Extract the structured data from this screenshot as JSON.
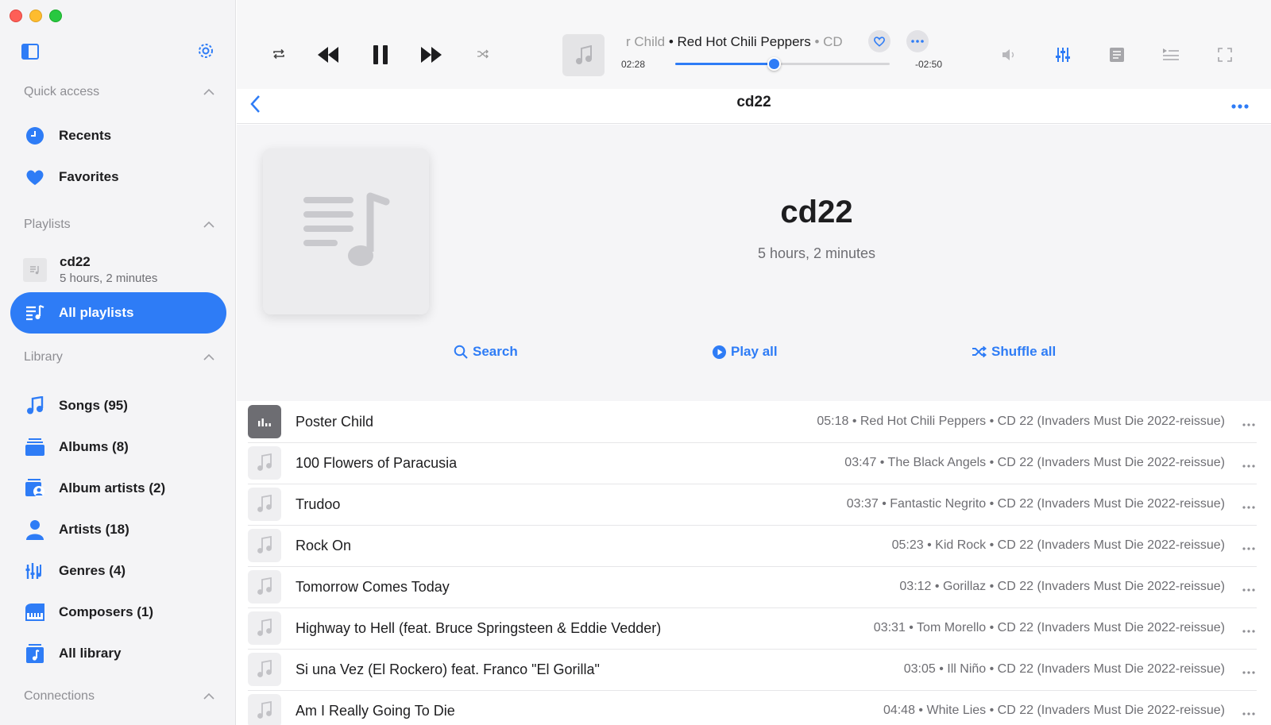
{
  "window": {
    "title": "cd22"
  },
  "sidebar": {
    "quick_access": {
      "heading": "Quick access",
      "items": [
        {
          "label": "Recents",
          "icon": "clock-icon"
        },
        {
          "label": "Favorites",
          "icon": "heart-icon"
        }
      ]
    },
    "playlists": {
      "heading": "Playlists",
      "playlist": {
        "title": "cd22",
        "subtitle": "5 hours, 2 minutes"
      },
      "all_label": "All playlists"
    },
    "library": {
      "heading": "Library",
      "items": [
        {
          "label": "Songs (95)",
          "icon": "music-note-icon"
        },
        {
          "label": "Albums (8)",
          "icon": "albums-icon"
        },
        {
          "label": "Album artists (2)",
          "icon": "album-artists-icon"
        },
        {
          "label": "Artists (18)",
          "icon": "person-icon"
        },
        {
          "label": "Genres (4)",
          "icon": "genres-icon"
        },
        {
          "label": "Composers (1)",
          "icon": "piano-icon"
        },
        {
          "label": "All library",
          "icon": "library-icon"
        }
      ]
    },
    "connections": {
      "heading": "Connections"
    }
  },
  "player": {
    "now_playing_prefix": "r Child",
    "now_playing_artist": " • Red Hot Chili Peppers",
    "now_playing_suffix": " • CD",
    "elapsed": "02:28",
    "remaining": "-02:50",
    "progress": 0.46
  },
  "header": {
    "title": "cd22"
  },
  "hero": {
    "title": "cd22",
    "subtitle": "5 hours, 2 minutes",
    "search_label": "Search",
    "play_all_label": "Play all",
    "shuffle_label": "Shuffle all"
  },
  "tracks": [
    {
      "title": "Poster Child",
      "meta": "05:18 • Red Hot Chili Peppers • CD 22 (Invaders Must Die 2022-reissue)",
      "playing": true
    },
    {
      "title": "100 Flowers of Paracusia",
      "meta": "03:47 • The Black Angels • CD 22 (Invaders Must Die 2022-reissue)"
    },
    {
      "title": "Trudoo",
      "meta": "03:37 • Fantastic Negrito • CD 22 (Invaders Must Die 2022-reissue)"
    },
    {
      "title": "Rock On",
      "meta": "05:23 • Kid Rock • CD 22 (Invaders Must Die 2022-reissue)"
    },
    {
      "title": "Tomorrow Comes Today",
      "meta": "03:12 • Gorillaz • CD 22 (Invaders Must Die 2022-reissue)"
    },
    {
      "title": "Highway to Hell (feat. Bruce Springsteen & Eddie Vedder)",
      "meta": "03:31 • Tom Morello • CD 22 (Invaders Must Die 2022-reissue)"
    },
    {
      "title": "Si una Vez (El Rockero) feat. Franco \"El Gorilla\"",
      "meta": "03:05 • Ill Niño • CD 22 (Invaders Must Die 2022-reissue)"
    },
    {
      "title": "Am I Really Going To Die",
      "meta": "04:48 • White Lies • CD 22 (Invaders Must Die 2022-reissue)"
    }
  ],
  "colors": {
    "accent": "#2e7cf6",
    "sidebar_bg": "#f4f4f6"
  }
}
